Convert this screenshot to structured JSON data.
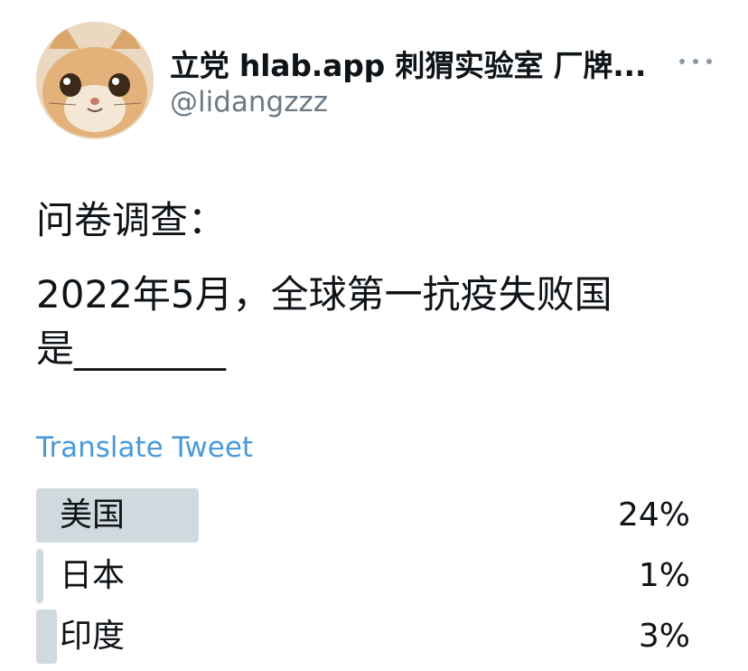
{
  "author": {
    "display_name": "立党 hlab.app 刺猬实验室 厂牌...",
    "handle": "@lidangzzz",
    "avatar_icon": "cat-face-avatar"
  },
  "more_icon": "more-horizontal-icon",
  "tweet": {
    "line1": "问卷调查：",
    "line2": "2022年5月，全球第一抗疫失败国",
    "line3": "是________"
  },
  "translate_label": "Translate Tweet",
  "poll": {
    "options": [
      {
        "label": "美国",
        "percent_text": "24%",
        "fraction": 0.24
      },
      {
        "label": "日本",
        "percent_text": "1%",
        "fraction": 0.01
      },
      {
        "label": "印度",
        "percent_text": "3%",
        "fraction": 0.03
      }
    ]
  },
  "colors": {
    "link": "#4a9ad9",
    "muted": "#6b7a86",
    "poll_fill": "#cfd9de",
    "text": "#0f1419"
  }
}
